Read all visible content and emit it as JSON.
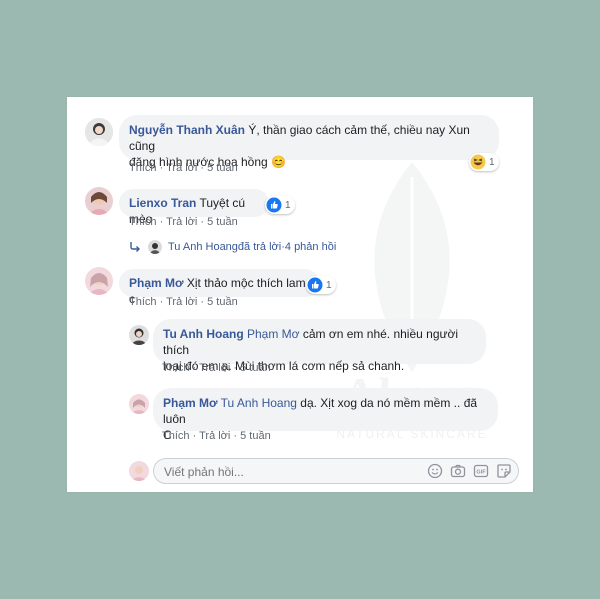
{
  "comments": [
    {
      "author": "Nguyễn Thanh Xuân",
      "text_line1": " Ý, thần giao cách cảm thế, chiều nay Xun cũng",
      "text_line2": "đăng hình nước hoa hồng ",
      "emoji": "😊",
      "like": "Thích",
      "reply": "Trả lời",
      "time": "5 tuần",
      "reaction_count": "1"
    },
    {
      "author": "Lienxo Tran",
      "text": " Tuyệt cú mèo",
      "like": "Thích",
      "reply": "Trả lời",
      "time": "5 tuần",
      "reaction_count": "1",
      "replies_summary": {
        "name": "Tu Anh Hoang",
        "action": " đã trả lời",
        "sep": " · ",
        "count": "4 phản hồi"
      }
    },
    {
      "author": "Phạm Mơ",
      "text": " Xịt thảo mộc thích lam c",
      "like": "Thích",
      "reply": "Trả lời",
      "time": "5 tuần",
      "reaction_count": "1",
      "replies": [
        {
          "author": "Tu Anh Hoang",
          "mention": " Phạm Mơ",
          "text_line1": " cảm ơn em nhé. nhiều người thích",
          "text_line2": "loại đó em ạ. Mùi thơm lá cơm nếp sả chanh.",
          "like": "Thích",
          "reply": "Trả lời",
          "time": "5 tuần"
        },
        {
          "author": "Phạm Mơ",
          "mention": " Tu Anh Hoang",
          "text_line1": " dạ. Xịt xog da nó mềm mềm .. đã luôn",
          "text_line2": "C",
          "like": "Thích",
          "reply": "Trả lời",
          "time": "5 tuần"
        }
      ]
    }
  ],
  "action_sep": " · ",
  "reply_input": {
    "placeholder": "Viết phản hồi..."
  },
  "watermark": {
    "text": "Akaya",
    "subtitle": "NATURAL SKINCARE"
  },
  "colors": {
    "background": "#9cb9b1",
    "name": "#385898",
    "bubble": "#f2f3f5",
    "like_blue": "#1877f2"
  },
  "icons": [
    "like-reaction-icon",
    "haha-reaction-icon",
    "reply-arrow-icon",
    "emoji-icon",
    "camera-icon",
    "gif-icon",
    "sticker-icon"
  ]
}
